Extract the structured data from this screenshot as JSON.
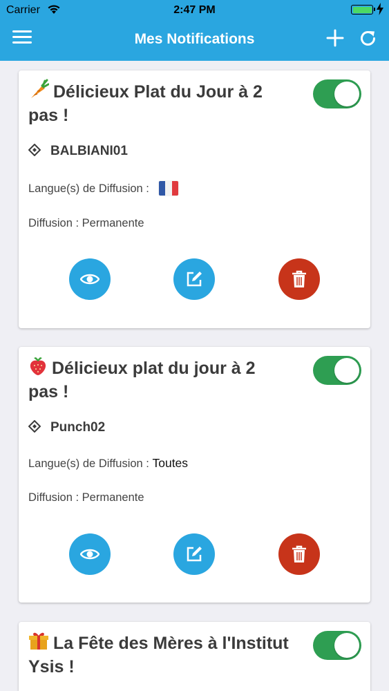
{
  "status_bar": {
    "carrier": "Carrier",
    "time": "2:47 PM",
    "battery_color": "#4cd964"
  },
  "nav": {
    "title": "Mes Notifications",
    "menu_icon": "hamburger-menu-icon",
    "add_icon": "plus-icon",
    "refresh_icon": "refresh-icon",
    "background": "#2aa6e0"
  },
  "notifications": [
    {
      "emoji": "carrot",
      "title": "Délicieux Plat du Jour à 2 pas !",
      "title_line1": "Délicieux Plat du Jour à 2",
      "title_line2": "pas !",
      "enabled": true,
      "code": "BALBIANI01",
      "languages_label": "Langue(s) de Diffusion :",
      "languages_value": "",
      "language_flag": "france-flag",
      "diffusion": "Diffusion : Permanente"
    },
    {
      "emoji": "strawberry",
      "title": "Délicieux plat du jour à 2 pas !",
      "title_line1": "Délicieux plat du jour à 2",
      "title_line2": "pas !",
      "enabled": true,
      "code": "Punch02",
      "languages_label": "Langue(s) de Diffusion :",
      "languages_value": "Toutes",
      "diffusion": "Diffusion : Permanente"
    },
    {
      "emoji": "gift",
      "title": "La Fête des Mères à l'Institut Ysis !",
      "title_line1": "La Fête des Mères à l'Institut",
      "title_line2": "Ysis !",
      "enabled": true
    }
  ],
  "colors": {
    "toggle_on": "#2e9e52",
    "view_button": "#2aa6e0",
    "edit_button": "#2aa6e0",
    "delete_button": "#c7341a"
  }
}
